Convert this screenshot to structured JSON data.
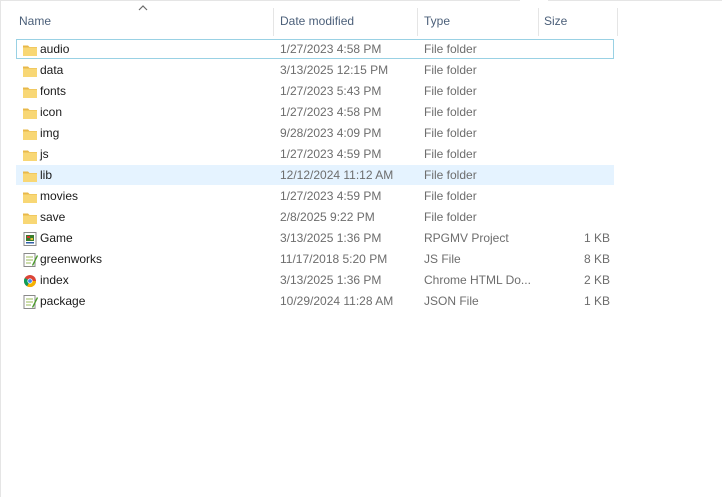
{
  "columns": {
    "name": "Name",
    "date": "Date modified",
    "type": "Type",
    "size": "Size"
  },
  "colors": {
    "folder": "#f8d775",
    "selected_bg": "#e5f3ff",
    "focus_border": "#99d1e4"
  },
  "files": [
    {
      "name": "audio",
      "date": "1/27/2023 4:58 PM",
      "type": "File folder",
      "size": "",
      "icon": "folder-icon"
    },
    {
      "name": "data",
      "date": "3/13/2025 12:15 PM",
      "type": "File folder",
      "size": "",
      "icon": "folder-icon"
    },
    {
      "name": "fonts",
      "date": "1/27/2023 5:43 PM",
      "type": "File folder",
      "size": "",
      "icon": "folder-icon"
    },
    {
      "name": "icon",
      "date": "1/27/2023 4:58 PM",
      "type": "File folder",
      "size": "",
      "icon": "folder-icon"
    },
    {
      "name": "img",
      "date": "9/28/2023 4:09 PM",
      "type": "File folder",
      "size": "",
      "icon": "folder-icon"
    },
    {
      "name": "js",
      "date": "1/27/2023 4:59 PM",
      "type": "File folder",
      "size": "",
      "icon": "folder-icon"
    },
    {
      "name": "lib",
      "date": "12/12/2024 11:12 AM",
      "type": "File folder",
      "size": "",
      "icon": "folder-icon"
    },
    {
      "name": "movies",
      "date": "1/27/2023 4:59 PM",
      "type": "File folder",
      "size": "",
      "icon": "folder-icon"
    },
    {
      "name": "save",
      "date": "2/8/2025 9:22 PM",
      "type": "File folder",
      "size": "",
      "icon": "folder-icon"
    },
    {
      "name": "Game",
      "date": "3/13/2025 1:36 PM",
      "type": "RPGMV Project",
      "size": "1 KB",
      "icon": "rpgmv-project-icon"
    },
    {
      "name": "greenworks",
      "date": "11/17/2018 5:20 PM",
      "type": "JS File",
      "size": "8 KB",
      "icon": "js-file-icon"
    },
    {
      "name": "index",
      "date": "3/13/2025 1:36 PM",
      "type": "Chrome HTML Do...",
      "size": "2 KB",
      "icon": "chrome-html-icon"
    },
    {
      "name": "package",
      "date": "10/29/2024 11:28 AM",
      "type": "JSON File",
      "size": "1 KB",
      "icon": "json-file-icon"
    }
  ]
}
